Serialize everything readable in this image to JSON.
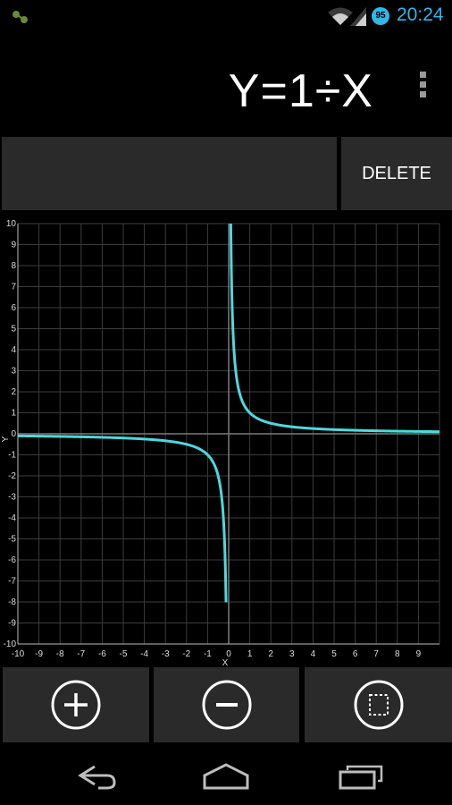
{
  "status_bar": {
    "time": "20:24",
    "battery_level": "95",
    "icons": [
      "notification-icon",
      "wifi-icon",
      "signal-icon",
      "battery-icon"
    ]
  },
  "header": {
    "formula": "Y=1÷X",
    "menu_icon": "overflow-menu-icon"
  },
  "input": {
    "value": "",
    "delete_label": "DELETE"
  },
  "chart_data": {
    "type": "line",
    "series": [
      {
        "function": "y = 1/x",
        "color": "#4fd8dc"
      }
    ],
    "xlabel": "X",
    "ylabel": "Y",
    "xlim": [
      -10,
      10
    ],
    "ylim": [
      -10,
      10
    ],
    "x_ticks": [
      "-10",
      "-9",
      "-8",
      "-7",
      "-6",
      "-5",
      "-4",
      "-3",
      "-2",
      "-1",
      "0",
      "1",
      "2",
      "3",
      "4",
      "5",
      "6",
      "7",
      "8",
      "9"
    ],
    "y_ticks": [
      "10",
      "9",
      "8",
      "7",
      "6",
      "5",
      "4",
      "3",
      "2",
      "1",
      "0",
      "-1",
      "-2",
      "-3",
      "-4",
      "-5",
      "-6",
      "-7",
      "-8",
      "-9",
      "-10"
    ],
    "grid": true,
    "colors": {
      "background": "#000000",
      "grid": "#3c3c3c",
      "axis": "#7a7a7a",
      "curve": "#4fd8dc"
    }
  },
  "controls": {
    "zoom_in": "zoom-in-icon",
    "zoom_out": "zoom-out-icon",
    "fit": "fit-screen-icon"
  },
  "nav_bar": {
    "icons": [
      "back-icon",
      "home-icon",
      "recent-apps-icon"
    ]
  }
}
